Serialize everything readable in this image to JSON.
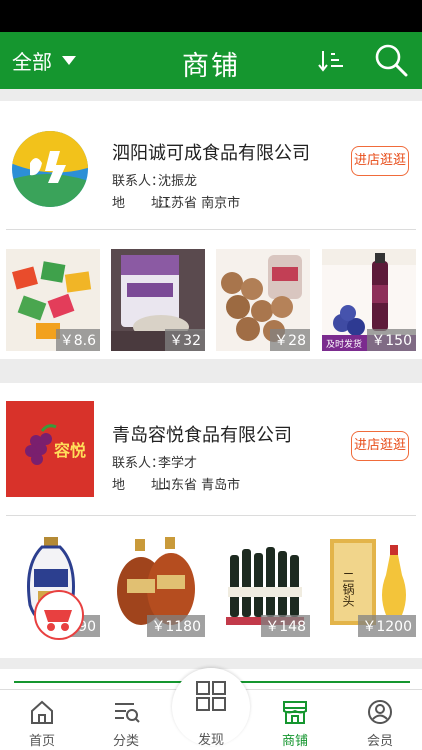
{
  "header": {
    "filter_label": "全部",
    "title": "商铺"
  },
  "shops": [
    {
      "name": "泗阳诚可成食品有限公司",
      "contact_key": "联系人：",
      "contact_value": "沈振龙",
      "address_key": "地　　址：",
      "address_value": "江苏省 南京市",
      "visit_label": "进店逛逛",
      "products": [
        {
          "price": "￥8.6"
        },
        {
          "price": "￥32"
        },
        {
          "price": "￥28"
        },
        {
          "price": "￥150"
        }
      ]
    },
    {
      "name": "青岛容悦食品有限公司",
      "contact_key": "联系人：",
      "contact_value": "李学才",
      "address_key": "地　　址：",
      "address_value": "山东省 青岛市",
      "visit_label": "进店逛逛",
      "logo_text": "容悦",
      "products": [
        {
          "price": "￥90"
        },
        {
          "price": "￥1180"
        },
        {
          "price": "￥148"
        },
        {
          "price": "￥1200"
        }
      ]
    }
  ],
  "product_overlay_text": {
    "p2_text": "复合谷物冲调粉",
    "p4_text": "及时发货",
    "p8_text": "二锅头"
  },
  "tabbar": {
    "home": "首页",
    "category": "分类",
    "discover": "发现",
    "shops": "商铺",
    "member": "会员"
  },
  "colors": {
    "brand_green": "#15962f",
    "accent_orange": "#e84e1b",
    "cart_red": "#e84040"
  },
  "icons": [
    "caret-down-icon",
    "sort-icon",
    "search-icon",
    "home-icon",
    "category-icon",
    "discover-icon",
    "shop-icon",
    "member-icon",
    "cart-icon"
  ]
}
